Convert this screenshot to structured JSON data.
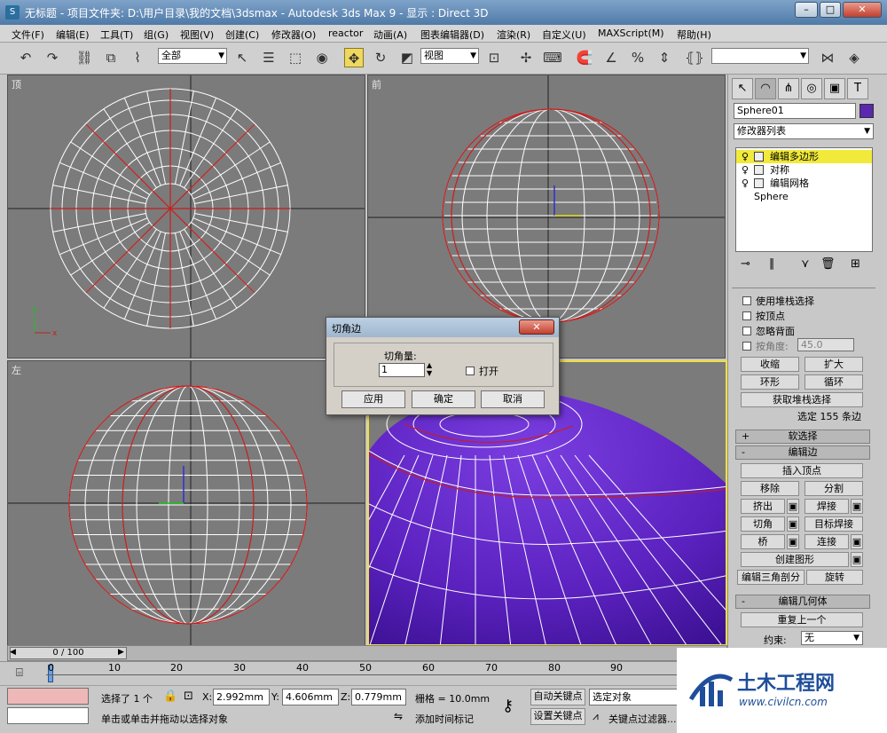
{
  "window": {
    "icon": "3ds-max-app-icon",
    "title": "无标题      - 项目文件夹: D:\\用户目录\\我的文档\\3dsmax      - Autodesk 3ds Max 9      - 显示 : Direct 3D",
    "minimize": "–",
    "maximize": "□",
    "close": "✕"
  },
  "menu": [
    "文件(F)",
    "编辑(E)",
    "工具(T)",
    "组(G)",
    "视图(V)",
    "创建(C)",
    "修改器(O)",
    "reactor",
    "动画(A)",
    "图表编辑器(D)",
    "渲染(R)",
    "自定义(U)",
    "MAXScript(M)",
    "帮助(H)"
  ],
  "toolbar": {
    "selection_filter": "全部",
    "reference_coord": "视图",
    "named_selection": ""
  },
  "viewports": {
    "top": "顶",
    "front": "前",
    "left": "左",
    "perspective": ""
  },
  "dialog": {
    "title": "切角边",
    "close": "✕",
    "amount_label": "切角量:",
    "amount_value": "1",
    "open_label": "打开",
    "apply": "应用",
    "ok": "确定",
    "cancel": "取消"
  },
  "panel": {
    "tabs": [
      "create-icon",
      "modify-icon",
      "hierarchy-icon",
      "motion-icon",
      "display-icon",
      "utilities-icon"
    ],
    "object_name": "Sphere01",
    "object_color": "#5b27b0",
    "modifier_list": "修改器列表",
    "stack": [
      {
        "label": "编辑多边形",
        "selected": true
      },
      {
        "label": "对称",
        "selected": false
      },
      {
        "label": "编辑网格",
        "selected": false
      },
      {
        "label": "Sphere",
        "selected": false
      }
    ],
    "selection": {
      "use_stack": "使用堆栈选择",
      "by_vertex": "按顶点",
      "ignore_backfacing": "忽略背面",
      "by_angle": "按角度:",
      "angle_value": "45.0",
      "shrink": "收缩",
      "grow": "扩大",
      "ring": "环形",
      "loop": "循环",
      "get_stack": "获取堆栈选择",
      "status": "选定 155 条边"
    },
    "soft_selection": "软选择",
    "edit_edges": {
      "title": "编辑边",
      "insert_vertex": "插入顶点",
      "remove": "移除",
      "split": "分割",
      "extrude": "挤出",
      "weld": "焊接",
      "chamfer": "切角",
      "target_weld": "目标焊接",
      "bridge": "桥",
      "connect": "连接",
      "create_shape": "创建图形",
      "edit_tri": "编辑三角剖分",
      "turn": "旋转"
    },
    "edit_geometry": {
      "title": "编辑几何体",
      "repeat_last": "重复上一个",
      "constraints": "约束:",
      "constraint_value": "无"
    }
  },
  "timeline": {
    "frame": "0 / 100",
    "ticks": [
      "0",
      "10",
      "20",
      "30",
      "40",
      "50",
      "60",
      "70",
      "80",
      "90"
    ]
  },
  "status": {
    "selected": "选择了 1 个",
    "x_label": "X:",
    "x": "2.992mm",
    "y_label": "Y:",
    "y": "4.606mm",
    "z_label": "Z:",
    "z": "0.779mm",
    "grid": "栅格 = 10.0mm",
    "prompt": "单击或单击并拖动以选择对象",
    "add_time_tag": "添加时间标记",
    "auto_key": "自动关键点",
    "selected_obj": "选定对象",
    "set_key": "设置关键点",
    "key_filter": "关键点过滤器..."
  },
  "watermark": {
    "name": "土木工程网",
    "url": "www.civilcn.com"
  }
}
